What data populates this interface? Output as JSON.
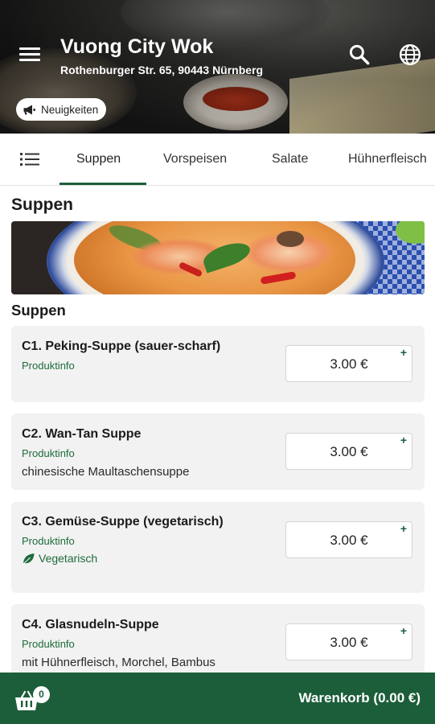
{
  "header": {
    "store_name": "Vuong City Wok",
    "address": "Rothenburger Str. 65, 90443 Nürnberg",
    "news_label": "Neuigkeiten",
    "icons": [
      "menu-icon",
      "search-icon",
      "globe-icon",
      "megaphone-icon"
    ]
  },
  "tabs": [
    {
      "label": "Suppen",
      "active": true
    },
    {
      "label": "Vorspeisen",
      "active": false
    },
    {
      "label": "Salate",
      "active": false
    },
    {
      "label": "Hühnerfleisch",
      "active": false
    }
  ],
  "category": {
    "title": "Suppen",
    "section_title": "Suppen"
  },
  "products": [
    {
      "name": "C1. Peking-Suppe (sauer-scharf)",
      "info": "Produktinfo",
      "description": "",
      "badge": "",
      "price": "3.00 €",
      "add": "+"
    },
    {
      "name": "C2. Wan-Tan Suppe",
      "info": "Produktinfo",
      "description": "chinesische Maultaschensuppe",
      "badge": "",
      "price": "3.00 €",
      "add": "+"
    },
    {
      "name": "C3. Gemüse-Suppe (vegetarisch)",
      "info": "Produktinfo",
      "description": "",
      "badge": "Vegetarisch",
      "price": "3.00 €",
      "add": "+"
    },
    {
      "name": "C4. Glasnudeln-Suppe",
      "info": "Produktinfo",
      "description": "mit Hühnerfleisch, Morchel, Bambus",
      "badge": "",
      "price": "3.00 €",
      "add": "+"
    }
  ],
  "cart": {
    "count": "0",
    "label": "Warenkorb (0.00 €)"
  },
  "colors": {
    "brand_green": "#1d5e3a",
    "info_green": "#1d6b3a",
    "card_bg": "#f2f2f2"
  }
}
